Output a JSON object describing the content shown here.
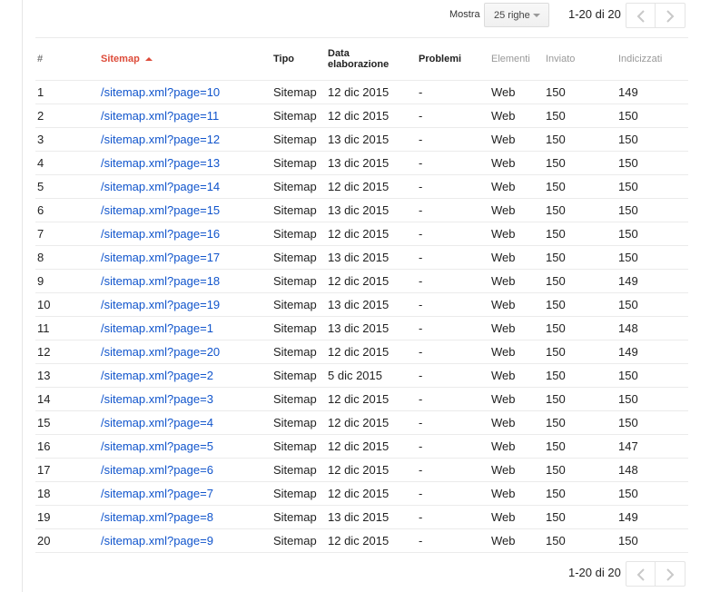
{
  "pager": {
    "show_label": "Mostra",
    "rows_option": "25 righe",
    "range_text": "1-20 di 20"
  },
  "table": {
    "headers": {
      "num": "#",
      "sitemap": "Sitemap",
      "type": "Tipo",
      "date_line1": "Data",
      "date_line2": "elaborazione",
      "problems": "Problemi",
      "elements": "Elementi",
      "submitted": "Inviato",
      "indexed": "Indicizzati"
    },
    "rows": [
      {
        "num": "1",
        "sitemap": "/sitemap.xml?page=10",
        "type": "Sitemap",
        "date": "12 dic 2015",
        "problems": "-",
        "elements": "Web",
        "submitted": "150",
        "indexed": "149"
      },
      {
        "num": "2",
        "sitemap": "/sitemap.xml?page=11",
        "type": "Sitemap",
        "date": "12 dic 2015",
        "problems": "-",
        "elements": "Web",
        "submitted": "150",
        "indexed": "150"
      },
      {
        "num": "3",
        "sitemap": "/sitemap.xml?page=12",
        "type": "Sitemap",
        "date": "13 dic 2015",
        "problems": "-",
        "elements": "Web",
        "submitted": "150",
        "indexed": "150"
      },
      {
        "num": "4",
        "sitemap": "/sitemap.xml?page=13",
        "type": "Sitemap",
        "date": "13 dic 2015",
        "problems": "-",
        "elements": "Web",
        "submitted": "150",
        "indexed": "150"
      },
      {
        "num": "5",
        "sitemap": "/sitemap.xml?page=14",
        "type": "Sitemap",
        "date": "12 dic 2015",
        "problems": "-",
        "elements": "Web",
        "submitted": "150",
        "indexed": "150"
      },
      {
        "num": "6",
        "sitemap": "/sitemap.xml?page=15",
        "type": "Sitemap",
        "date": "13 dic 2015",
        "problems": "-",
        "elements": "Web",
        "submitted": "150",
        "indexed": "150"
      },
      {
        "num": "7",
        "sitemap": "/sitemap.xml?page=16",
        "type": "Sitemap",
        "date": "12 dic 2015",
        "problems": "-",
        "elements": "Web",
        "submitted": "150",
        "indexed": "150"
      },
      {
        "num": "8",
        "sitemap": "/sitemap.xml?page=17",
        "type": "Sitemap",
        "date": "13 dic 2015",
        "problems": "-",
        "elements": "Web",
        "submitted": "150",
        "indexed": "150"
      },
      {
        "num": "9",
        "sitemap": "/sitemap.xml?page=18",
        "type": "Sitemap",
        "date": "12 dic 2015",
        "problems": "-",
        "elements": "Web",
        "submitted": "150",
        "indexed": "149"
      },
      {
        "num": "10",
        "sitemap": "/sitemap.xml?page=19",
        "type": "Sitemap",
        "date": "13 dic 2015",
        "problems": "-",
        "elements": "Web",
        "submitted": "150",
        "indexed": "150"
      },
      {
        "num": "11",
        "sitemap": "/sitemap.xml?page=1",
        "type": "Sitemap",
        "date": "13 dic 2015",
        "problems": "-",
        "elements": "Web",
        "submitted": "150",
        "indexed": "148"
      },
      {
        "num": "12",
        "sitemap": "/sitemap.xml?page=20",
        "type": "Sitemap",
        "date": "12 dic 2015",
        "problems": "-",
        "elements": "Web",
        "submitted": "150",
        "indexed": "149"
      },
      {
        "num": "13",
        "sitemap": "/sitemap.xml?page=2",
        "type": "Sitemap",
        "date": "5 dic 2015",
        "problems": "-",
        "elements": "Web",
        "submitted": "150",
        "indexed": "150"
      },
      {
        "num": "14",
        "sitemap": "/sitemap.xml?page=3",
        "type": "Sitemap",
        "date": "12 dic 2015",
        "problems": "-",
        "elements": "Web",
        "submitted": "150",
        "indexed": "150"
      },
      {
        "num": "15",
        "sitemap": "/sitemap.xml?page=4",
        "type": "Sitemap",
        "date": "12 dic 2015",
        "problems": "-",
        "elements": "Web",
        "submitted": "150",
        "indexed": "150"
      },
      {
        "num": "16",
        "sitemap": "/sitemap.xml?page=5",
        "type": "Sitemap",
        "date": "12 dic 2015",
        "problems": "-",
        "elements": "Web",
        "submitted": "150",
        "indexed": "147"
      },
      {
        "num": "17",
        "sitemap": "/sitemap.xml?page=6",
        "type": "Sitemap",
        "date": "12 dic 2015",
        "problems": "-",
        "elements": "Web",
        "submitted": "150",
        "indexed": "148"
      },
      {
        "num": "18",
        "sitemap": "/sitemap.xml?page=7",
        "type": "Sitemap",
        "date": "12 dic 2015",
        "problems": "-",
        "elements": "Web",
        "submitted": "150",
        "indexed": "150"
      },
      {
        "num": "19",
        "sitemap": "/sitemap.xml?page=8",
        "type": "Sitemap",
        "date": "13 dic 2015",
        "problems": "-",
        "elements": "Web",
        "submitted": "150",
        "indexed": "149"
      },
      {
        "num": "20",
        "sitemap": "/sitemap.xml?page=9",
        "type": "Sitemap",
        "date": "12 dic 2015",
        "problems": "-",
        "elements": "Web",
        "submitted": "150",
        "indexed": "150"
      }
    ]
  },
  "colors": {
    "link": "#1155cc",
    "sorted_header": "#dd4b39",
    "row_divider": "#ebebeb"
  },
  "icons": {
    "prev": "chevron-left-icon",
    "next": "chevron-right-icon",
    "dropdown": "caret-down-icon",
    "sort": "sort-ascending-icon"
  }
}
